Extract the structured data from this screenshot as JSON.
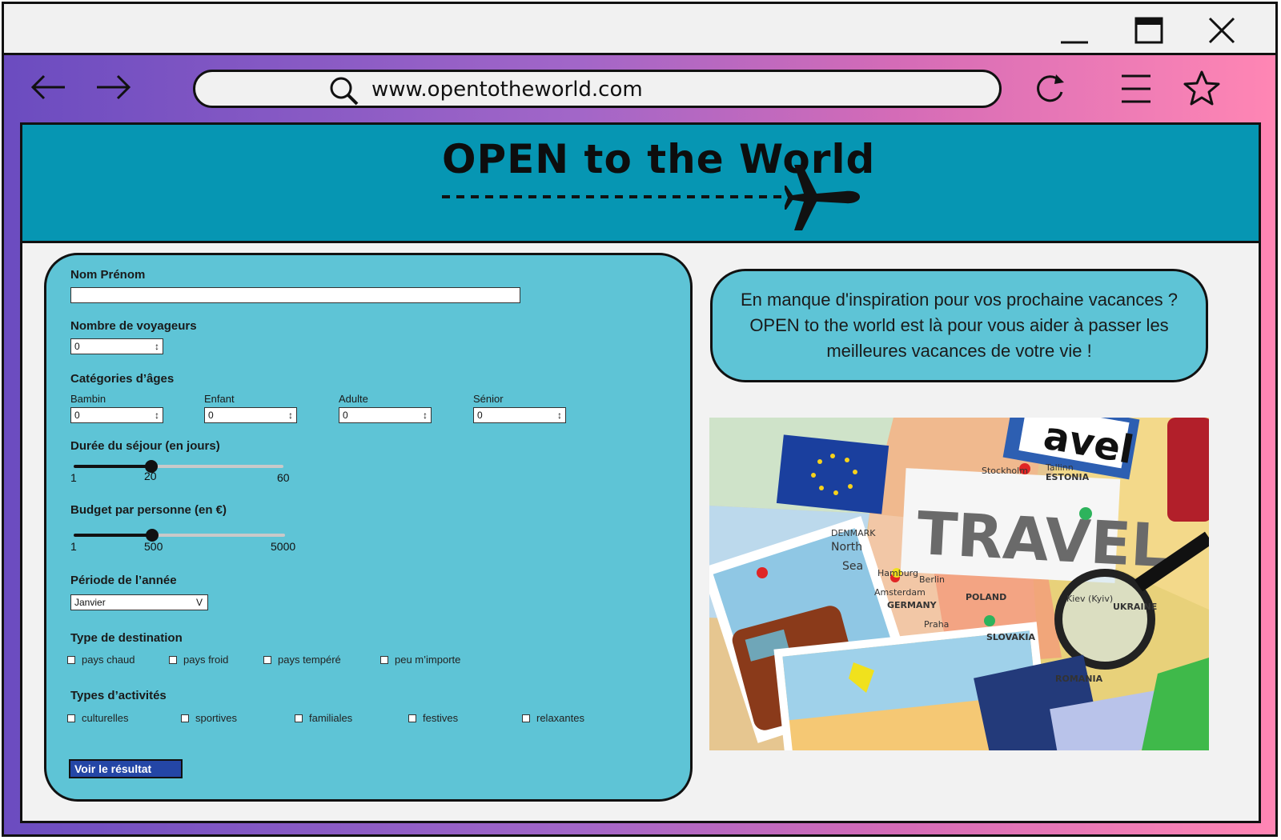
{
  "browser": {
    "url": "www.opentotheworld.com",
    "accent_start": "#6b4cc0",
    "accent_end": "#ff86b4"
  },
  "site": {
    "title": "OPEN to the World",
    "header_color": "#0696b3"
  },
  "form": {
    "name_label": "Nom Prénom",
    "name_value": "",
    "travellers_label": "Nombre de voyageurs",
    "travellers_value": "0",
    "ages_label": "Catégories d’âges",
    "ages": [
      {
        "label": "Bambin",
        "value": "0"
      },
      {
        "label": "Enfant",
        "value": "0"
      },
      {
        "label": "Adulte",
        "value": "0"
      },
      {
        "label": "Sénior",
        "value": "0"
      }
    ],
    "duration": {
      "label": "Durée du séjour (en jours)",
      "min": "1",
      "value": "20",
      "max": "60",
      "fill_fraction": 0.37
    },
    "budget": {
      "label": "Budget par personne (en €)",
      "min": "1",
      "value": "500",
      "max": "5000",
      "fill_fraction": 0.37
    },
    "period_label": "Période de l’année",
    "period_value": "Janvier",
    "period_arrow": "V",
    "destination_label": "Type de destination",
    "destinations": [
      "pays chaud",
      "pays froid",
      "pays tempéré",
      "peu m’importe"
    ],
    "activities_label": "Types d’activités",
    "activities": [
      "culturelles",
      "sportives",
      "familiales",
      "festives",
      "relaxantes"
    ],
    "submit_label": "Voir le résultat"
  },
  "info": {
    "text": "En manque d'inspiration pour vos prochaine vacances ? OPEN to the world est là pour vous aider à passer les meilleures vacances de votre vie !"
  },
  "photo": {
    "sign_text": "TRAVEL",
    "corner_sign_text": "avel",
    "map_labels": [
      "DENMARK",
      "North",
      "Sea",
      "Berlin",
      "POLAND",
      "GERMANY",
      "Amsterdam",
      "Praha",
      "SLOVAKIA",
      "ROMANIA",
      "UKRAINE",
      "Kiev (Kyiv)",
      "Hamburg",
      "Stockholm",
      "ESTONIA",
      "Tallinn"
    ]
  }
}
